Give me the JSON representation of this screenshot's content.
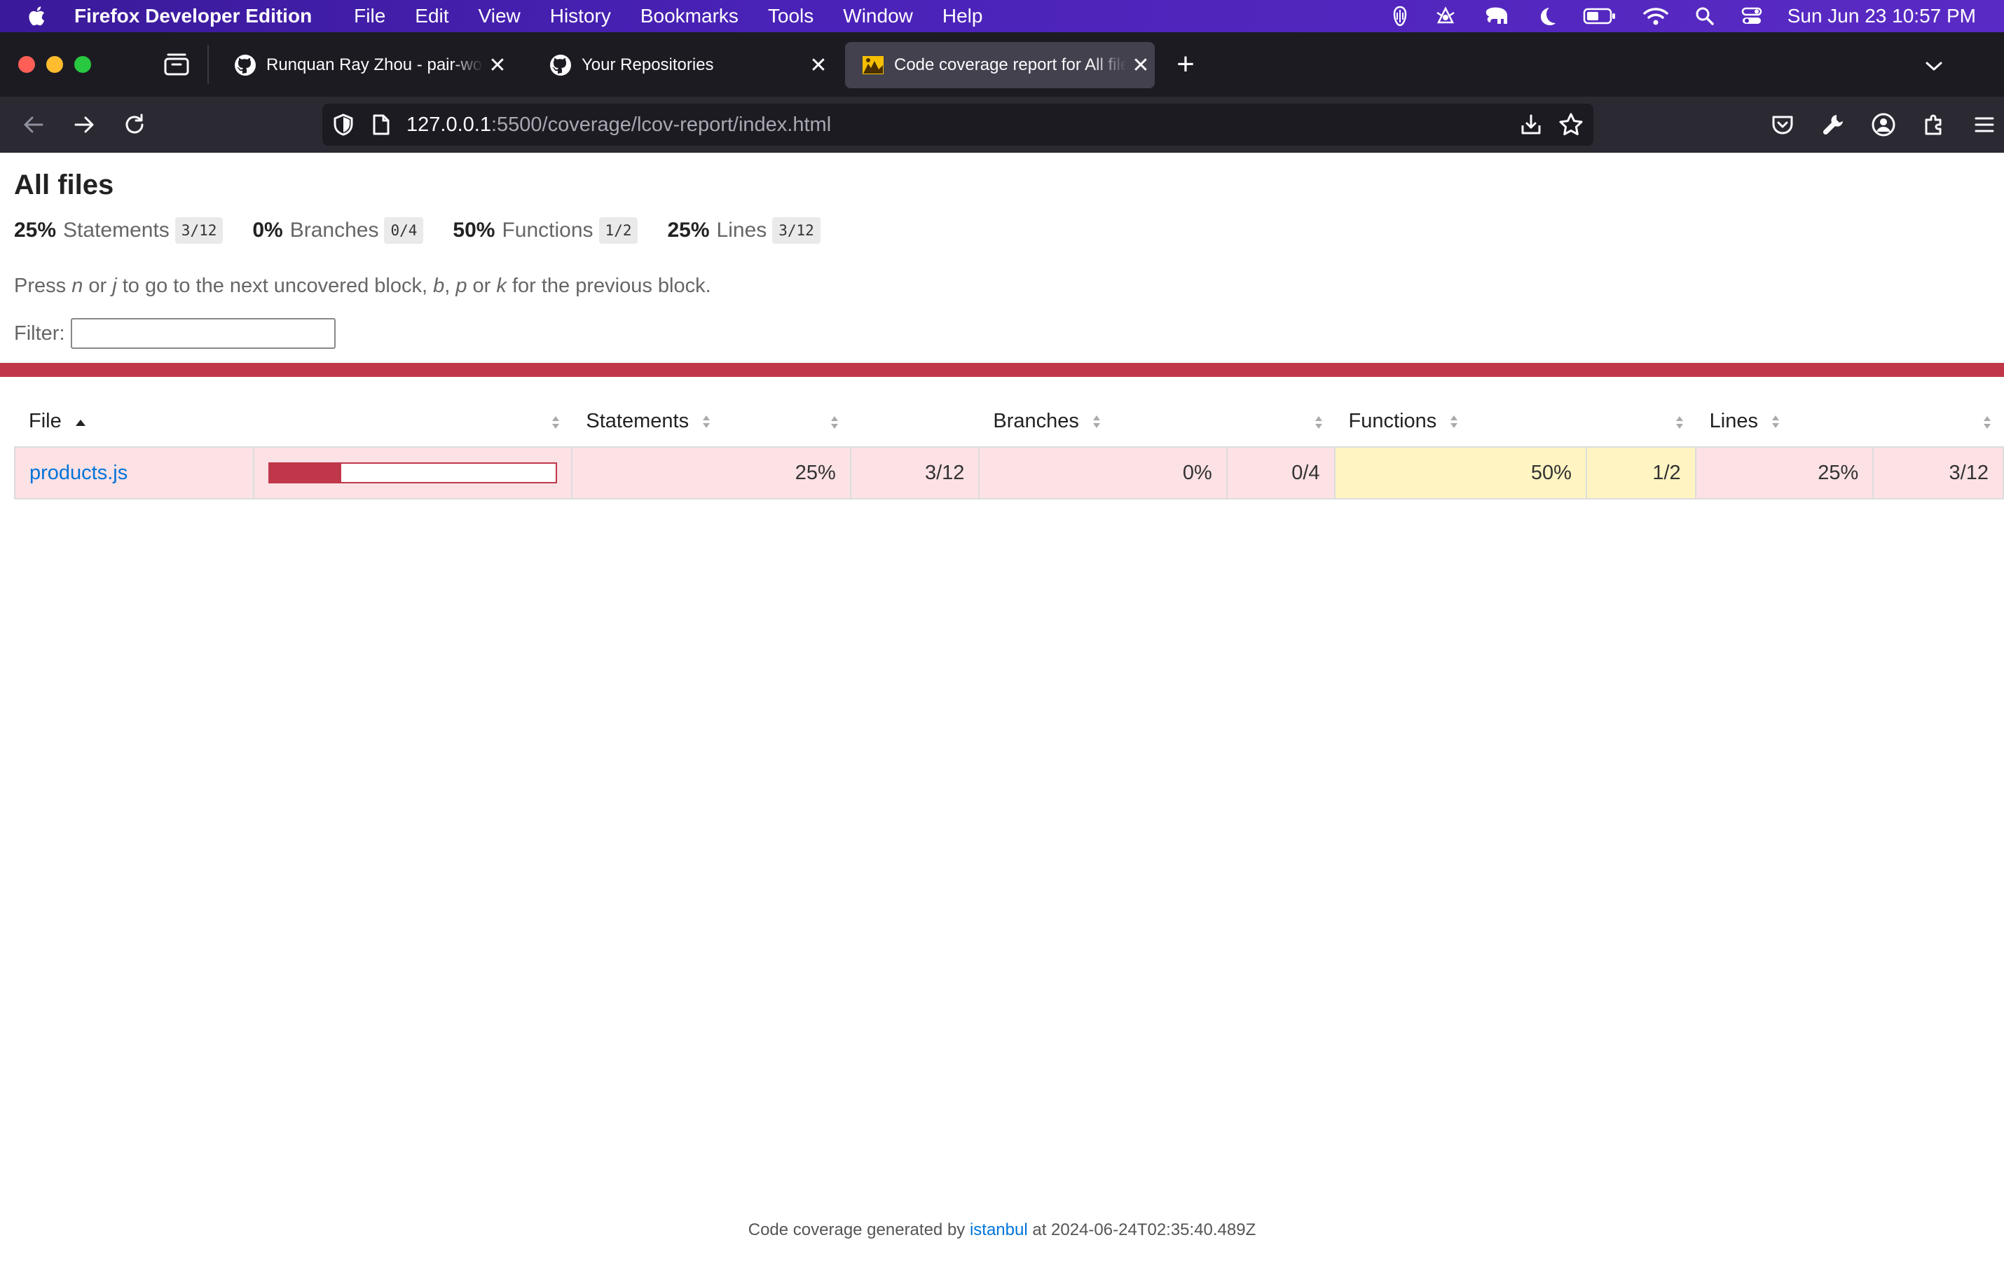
{
  "menubar": {
    "app_name": "Firefox Developer Edition",
    "menus": [
      "File",
      "Edit",
      "View",
      "History",
      "Bookmarks",
      "Tools",
      "Window",
      "Help"
    ],
    "clock": "Sun Jun 23  10:57 PM"
  },
  "tabs": [
    {
      "title": "Runquan Ray Zhou - pair-work-",
      "icon": "github-icon"
    },
    {
      "title": "Your Repositories",
      "icon": "github-icon"
    },
    {
      "title": "Code coverage report for All files",
      "icon": "istanbul-icon",
      "active": true
    }
  ],
  "urlbar": {
    "host": "127.0.0.1",
    "path": ":5500/coverage/lcov-report/index.html"
  },
  "page": {
    "title": "All files",
    "summary": [
      {
        "pct": "25%",
        "label": "Statements",
        "fraction": "3/12"
      },
      {
        "pct": "0%",
        "label": "Branches",
        "fraction": "0/4"
      },
      {
        "pct": "50%",
        "label": "Functions",
        "fraction": "1/2"
      },
      {
        "pct": "25%",
        "label": "Lines",
        "fraction": "3/12"
      }
    ],
    "hint": {
      "p1": "Press ",
      "k1": "n",
      "p2": " or ",
      "k2": "j",
      "p3": " to go to the next uncovered block, ",
      "k3": "b",
      "p4": ", ",
      "k4": "p",
      "p5": " or ",
      "k5": "k",
      "p6": " for the previous block."
    },
    "filter_label": "Filter:",
    "filter_value": "",
    "table": {
      "headers": {
        "file": "File",
        "statements": "Statements",
        "branches": "Branches",
        "functions": "Functions",
        "lines": "Lines"
      },
      "rows": [
        {
          "file": "products.js",
          "coverage_fraction": 0.25,
          "statements_pct": "25%",
          "statements_frac": "3/12",
          "branches_pct": "0%",
          "branches_frac": "0/4",
          "functions_pct": "50%",
          "functions_frac": "1/2",
          "lines_pct": "25%",
          "lines_frac": "3/12"
        }
      ]
    },
    "footer": {
      "prefix": "Code coverage generated by ",
      "link": "istanbul",
      "suffix": " at 2024-06-24T02:35:40.489Z"
    }
  },
  "colors": {
    "low": "#fce1e5",
    "medium": "#fff4c2",
    "bar": "#c0374a",
    "link": "#0074d9"
  }
}
